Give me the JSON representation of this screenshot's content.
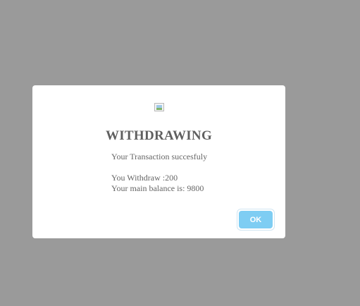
{
  "dialog": {
    "icon": "broken-image-icon",
    "title": "WITHDRAWING",
    "status_text": "Your Transaction succesfuly",
    "withdraw_text": "You Withdraw :200",
    "balance_text": "Your main balance is: 9800",
    "ok_label": "OK"
  },
  "colors": {
    "overlay": "#9a9a9a",
    "dialog_background": "#ffffff",
    "title": "#5f5f5f",
    "text": "#666666",
    "ok_button": "#7ecdf3"
  }
}
